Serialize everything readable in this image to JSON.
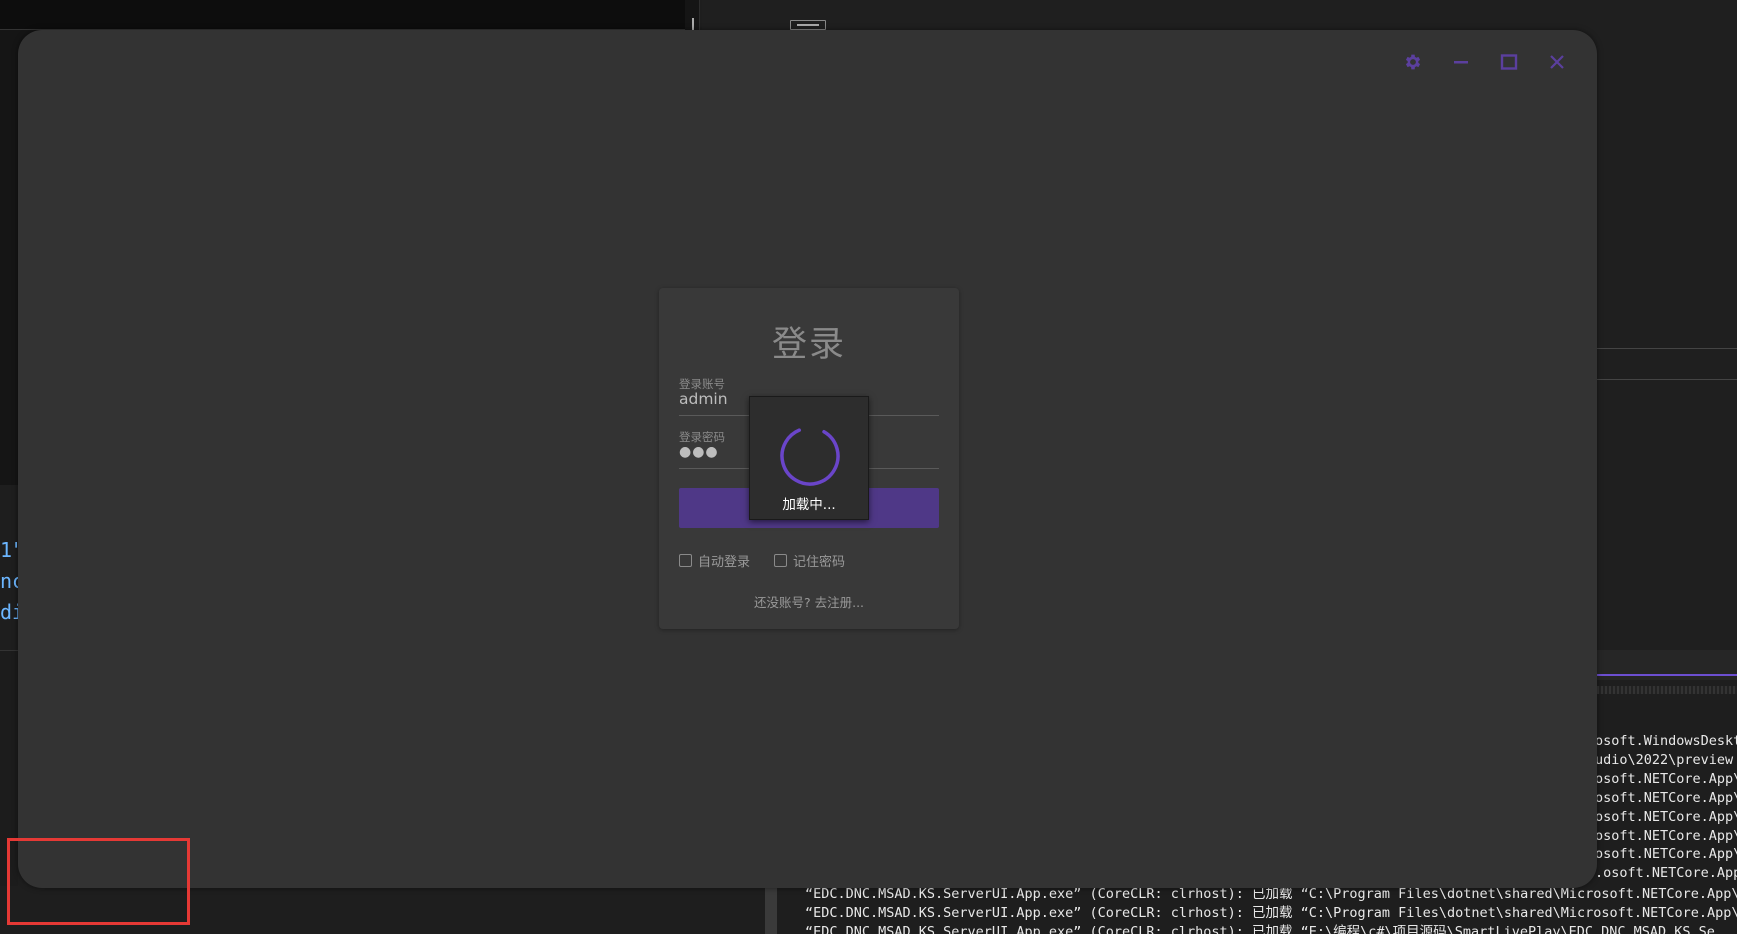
{
  "background": {
    "left_code_lines": [
      "1\"",
      "nc",
      "di"
    ],
    "output_right_lines": [
      "osoft.WindowsDeskt",
      "udio\\2022\\preview",
      "osoft.NETCore.App\\",
      "osoft.NETCore.App\\",
      "osoft.NETCore.App\\",
      "osoft.NETCore.App\\",
      "osoft.NETCore.App\\",
      ".osoft.NETCore.App\\"
    ],
    "output_bottom_lines": [
      "“EDC.DNC.MSAD.KS.ServerUI.App.exe” (CoreCLR: clrhost): 已加载 “C:\\Program Files\\dotnet\\shared\\Microsoft.NETCore.App\\",
      "“EDC.DNC.MSAD.KS.ServerUI.App.exe” (CoreCLR: clrhost): 已加载 “C:\\Program Files\\dotnet\\shared\\Microsoft.NETCore.App\\",
      "“EDC.DNC.MSAD.KS.ServerUI.App.exe” (CoreCLR: clrhost): 已加载 “E:\\编程\\c#\\项目源码\\SmartLivePlay\\EDC.DNC.MSAD.KS.Se"
    ]
  },
  "window": {
    "controls": {
      "settings_icon": "gear-icon",
      "minimize_icon": "minimize-icon",
      "maximize_icon": "maximize-icon",
      "close_icon": "close-icon",
      "color": "#5b3f9e"
    }
  },
  "login": {
    "title": "登录",
    "account_label": "登录账号",
    "account_value": "admin",
    "password_label": "登录密码",
    "password_value": "●●●",
    "button_color": "#4f3887",
    "auto_login_label": "自动登录",
    "remember_label": "记住密码",
    "register_link": "还没账号? 去注册..."
  },
  "loading": {
    "text": "加载中...",
    "spinner_color": "#6a45c9"
  }
}
